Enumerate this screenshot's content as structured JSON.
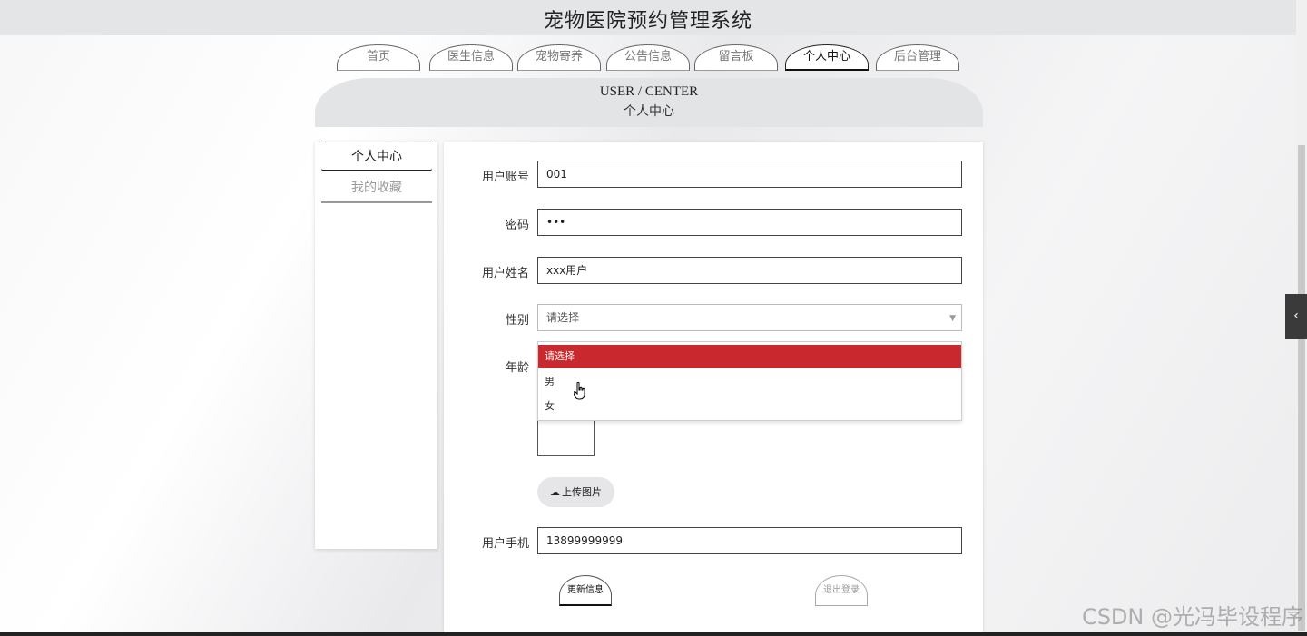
{
  "site_title": "宠物医院预约管理系统",
  "nav": {
    "tabs": [
      "首页",
      "医生信息",
      "宠物寄养",
      "公告信息",
      "留言板",
      "个人中心",
      "后台管理"
    ],
    "active_index": 5
  },
  "banner": {
    "en": "USER / CENTER",
    "cn": "个人中心"
  },
  "sidebar": {
    "items": [
      "个人中心",
      "我的收藏"
    ]
  },
  "form": {
    "account_label": "用户账号",
    "account_value": "001",
    "password_label": "密码",
    "password_value": "•••",
    "name_label": "用户姓名",
    "name_value": "xxx用户",
    "gender_label": "性别",
    "gender_value": "请选择",
    "age_label": "年龄",
    "phone_label": "用户手机",
    "phone_value": "13899999999"
  },
  "gender_options": [
    "请选择",
    "男",
    "女"
  ],
  "buttons": {
    "upload": "上传图片",
    "update": "更新信息",
    "logout": "退出登录"
  },
  "watermark": "CSDN @光冯毕设程序",
  "colors": {
    "highlight": "#c8282e",
    "toggle": "#3a3a3a"
  },
  "icons": {
    "upload": "cloud-upload-icon",
    "toggle": "chevron-left-icon",
    "caret": "caret-down-icon"
  }
}
